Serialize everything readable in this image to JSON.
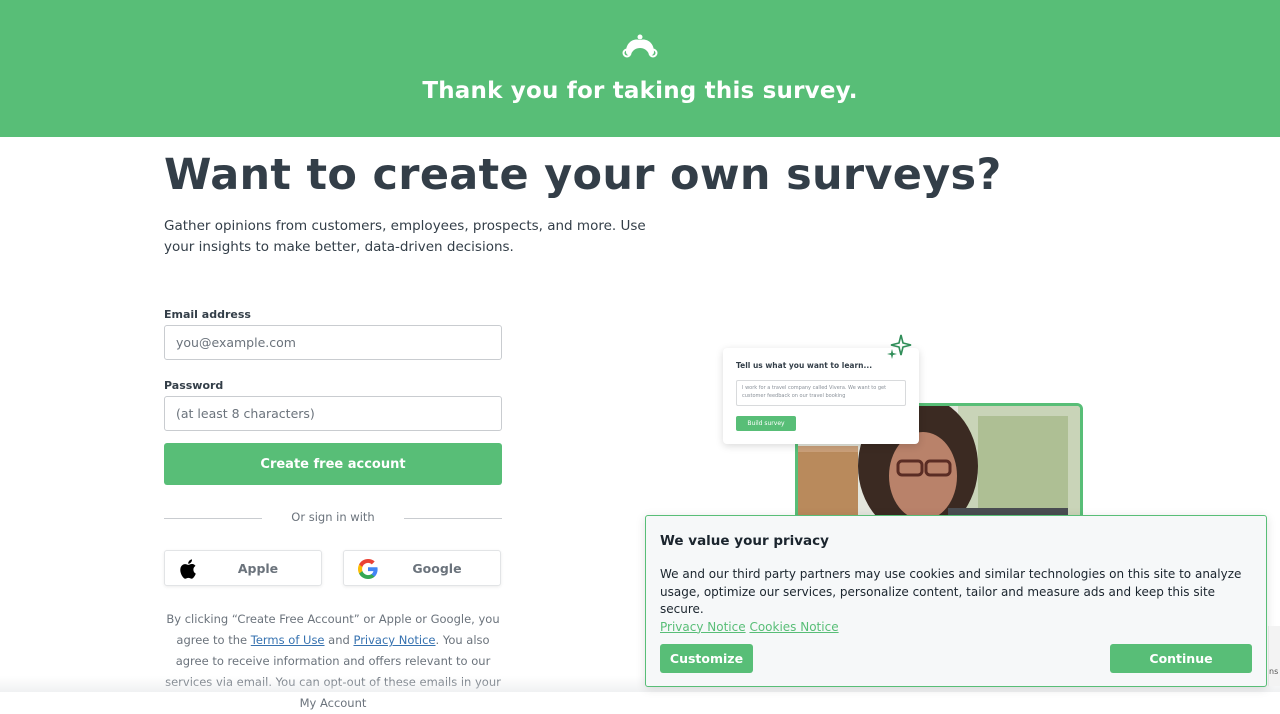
{
  "header": {
    "title": "Thank you for taking this survey.",
    "logo": "surveymonkey-logo-icon",
    "bg_color": "#58be77"
  },
  "hero": {
    "title": "Want to create your own surveys?",
    "subtitle": "Gather opinions from customers, employees, prospects, and more. Use your insights to make better, data-driven decisions."
  },
  "signup": {
    "email_label": "Email address",
    "email_placeholder": "you@example.com",
    "email_value": "",
    "password_label": "Password",
    "password_placeholder": "(at least 8 characters)",
    "password_value": "",
    "submit_label": "Create free account",
    "or_text": "Or sign in with",
    "apple_label": "Apple",
    "google_label": "Google",
    "legal_1": "By clicking “Create Free Account” or Apple or Google, you agree to the ",
    "terms_link": "Terms of Use",
    "legal_2": " and ",
    "privacy_link": "Privacy Notice",
    "legal_3": ". You also agree to receive information and offers relevant to our services via email. You can opt-out of these emails in your My Account"
  },
  "illustration": {
    "card_title": "Tell us what you want to learn...",
    "card_input": "I work for a travel company called Vivera. We want to get customer feedback on our travel booking",
    "card_button": "Build survey"
  },
  "cookie": {
    "title": "We value your privacy",
    "body": "We and our third party partners may use cookies and similar technologies on this site to analyze usage, optimize our services, personalize content, tailor and measure ads and keep this site secure.",
    "privacy_link": "Privacy Notice",
    "cookies_link": "Cookies Notice",
    "customize_label": "Customize",
    "continue_label": "Continue"
  },
  "recaptcha": {
    "fragment": "ns"
  },
  "colors": {
    "accent": "#58be77",
    "text": "#333e48",
    "muted": "#6b737c",
    "link": "#3672b0"
  }
}
